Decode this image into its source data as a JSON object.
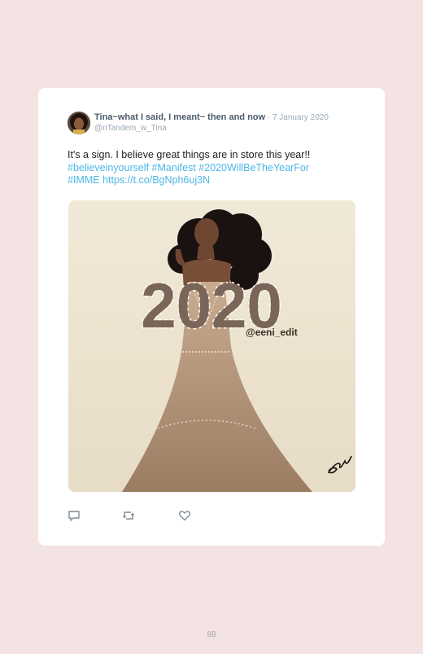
{
  "tweet": {
    "author_name": "Tina~what I said, I meant~ then and now",
    "separator": " · ",
    "date": "7 January 2020",
    "handle": "@nTandem_w_Tina",
    "text_plain": "It's a sign. I believe great things are in store this year!! ",
    "hashtags": [
      "#believeinyourself",
      "#Manifest",
      "#2020WillBeTheYearFor",
      "#IMME"
    ],
    "link": "https://t.co/BgNph6uj3N",
    "media": {
      "big_text": "2020",
      "watermark": "@eeni_edit"
    }
  },
  "actions": {
    "icons": [
      "reply-icon",
      "retweet-icon",
      "like-icon"
    ]
  },
  "page_number": "88"
}
